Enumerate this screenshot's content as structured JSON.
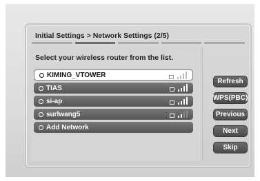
{
  "dialog": {
    "title": "Initial Settings > Network Settings (2/5)",
    "prompt": "Select your wireless router from the list.",
    "steps_total": 5,
    "step_current": 2
  },
  "networks": [
    {
      "name": "KIMING_VTOWER",
      "selected": true,
      "signal_bars": 4
    },
    {
      "name": "TIAS",
      "selected": false,
      "signal_bars": 4
    },
    {
      "name": "si-ap",
      "selected": false,
      "signal_bars": 4
    },
    {
      "name": "surlwang5",
      "selected": false,
      "signal_bars": 2
    },
    {
      "name": "Add Network",
      "selected": false,
      "signal_bars": 0
    }
  ],
  "buttons": {
    "refresh": "Refresh",
    "wps": "WPS(PBC)",
    "previous": "Previous",
    "next": "Next",
    "skip": "Skip"
  }
}
